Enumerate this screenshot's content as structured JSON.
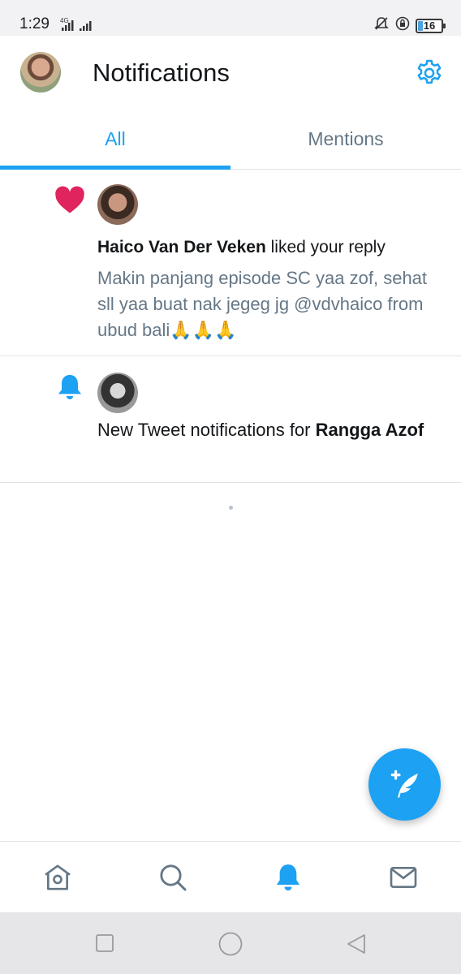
{
  "status_bar": {
    "time": "1:29",
    "network": "4G",
    "battery": "16"
  },
  "header": {
    "title": "Notifications"
  },
  "tabs": [
    {
      "label": "All",
      "active": true
    },
    {
      "label": "Mentions",
      "active": false
    }
  ],
  "notifications": [
    {
      "type": "like",
      "icon": "heart-icon",
      "user": "Haico Van Der Veken",
      "action": " liked your reply",
      "body": "Makin panjang episode SC yaa zof, sehat sll yaa buat nak jegeg jg @vdvhaico from ubud bali🙏🙏🙏"
    },
    {
      "type": "tweet-notification",
      "icon": "bell-icon",
      "prefix": "New Tweet notifications for ",
      "user": "Rangga Azof"
    }
  ],
  "bottom_nav": [
    "home-icon",
    "search-icon",
    "notifications-bell-icon",
    "messages-envelope-icon"
  ],
  "colors": {
    "accent": "#1da1f2",
    "heart": "#e0245e",
    "muted": "#657786"
  }
}
